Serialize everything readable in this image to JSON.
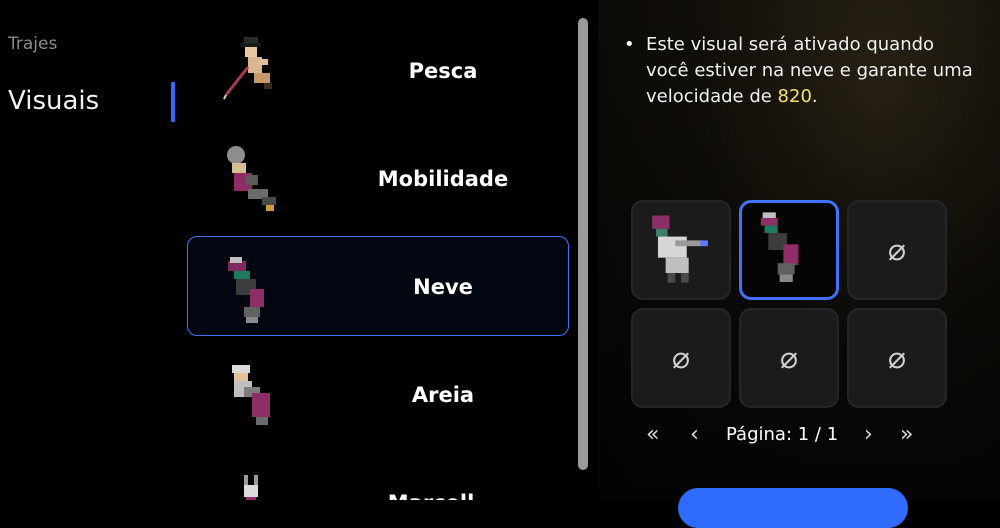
{
  "nav": {
    "items": [
      {
        "label": "Trajes"
      },
      {
        "label": "Visuais"
      }
    ]
  },
  "list": {
    "rows": [
      {
        "label": "Pesca"
      },
      {
        "label": "Mobilidade"
      },
      {
        "label": "Neve",
        "selected": true
      },
      {
        "label": "Areia"
      },
      {
        "label": "Marcell..."
      }
    ]
  },
  "details": {
    "bullet": "•",
    "text_before": "Este visual será ativado quando você estiver na neve e garante uma velocidade de ",
    "speed_value": "820",
    "text_after": "."
  },
  "grid": {
    "empty_symbol": "⌀",
    "cells": [
      {
        "state": "skin"
      },
      {
        "state": "skin",
        "selected": true
      },
      {
        "state": "empty"
      },
      {
        "state": "empty"
      },
      {
        "state": "empty"
      },
      {
        "state": "empty"
      }
    ]
  },
  "pager": {
    "first_icon": "«",
    "prev_icon": "‹",
    "label": "Página: 1 / 1",
    "next_icon": "›",
    "last_icon": "»"
  },
  "colors": {
    "accent": "#3f72ff",
    "highlight": "#f0e26d"
  }
}
